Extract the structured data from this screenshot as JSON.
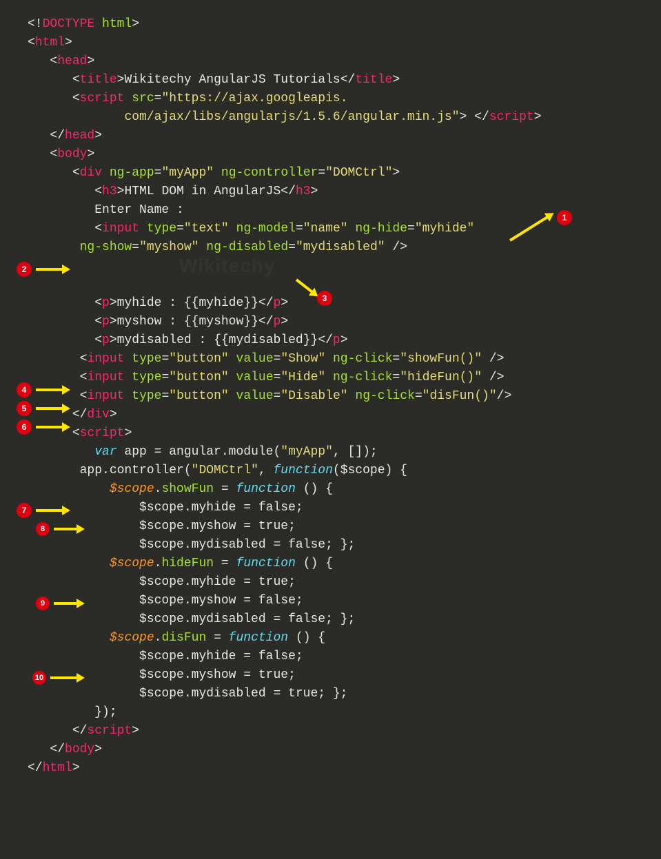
{
  "badges": {
    "b1": "1",
    "b2": "2",
    "b3": "3",
    "b4": "4",
    "b5": "5",
    "b6": "6",
    "b7": "7",
    "b8": "8",
    "b9": "9",
    "b10": "10"
  },
  "code": {
    "doctype_open": "<!",
    "doctype_tag": "DOCTYPE",
    "doctype_html": " html",
    "doctype_close": ">",
    "lt": "<",
    "gt": ">",
    "lt_close": "</",
    "sp_slash_gt": " />",
    "tag_html": "html",
    "tag_head": "head",
    "tag_title": "title",
    "title_text": "Wikitechy AngularJS Tutorials",
    "tag_script": "script",
    "attr_src": "src",
    "eq": "=",
    "src_val_line1": "\"https://ajax.googleapis.",
    "src_val_line2": "com/ajax/libs/angularjs/1.5.6/angular.min.js\"",
    "tag_body": "body",
    "tag_div": "div",
    "attr_ng_app": "ng-app",
    "ng_app_val": "\"myApp\"",
    "attr_ng_controller": "ng-controller",
    "ng_controller_val": "\"DOMCtrl\"",
    "tag_h3": "h3",
    "h3_text": "HTML DOM in AngularJS",
    "enter_name": "Enter Name :",
    "tag_input": "input",
    "attr_type": "type",
    "type_text": "\"text\"",
    "attr_ng_model": "ng-model",
    "ng_model_val": "\"name\"",
    "attr_ng_hide": "ng-hide",
    "ng_hide_val": "\"myhide\"",
    "attr_ng_show": "ng-show",
    "ng_show_val": "\"myshow\"",
    "attr_ng_disabled": "ng-disabled",
    "ng_disabled_val": "\"mydisabled\"",
    "tag_p": "p",
    "p_myhide": "myhide : {{myhide}}",
    "p_myshow": "myshow : {{myshow}}",
    "p_mydisabled": "mydisabled : {{mydisabled}}",
    "type_button": "\"button\"",
    "attr_value": "value",
    "val_show": "\"Show\"",
    "val_hide": "\"Hide\"",
    "val_disable": "\"Disable\"",
    "attr_ng_click": "ng-click",
    "ng_click_show": "\"showFun()\"",
    "ng_click_hide": "\"hideFun()\"",
    "ng_click_dis": "\"disFun()\"",
    "kw_var": "var",
    "js_app": " app ",
    "js_eq": "= ",
    "js_angular_module": "angular.module(",
    "js_myapp_str": "\"myApp\"",
    "js_comma_arr": ", []);",
    "js_app_controller": "app.controller(",
    "js_domctrl_str": "\"DOMCtrl\"",
    "js_comma": ", ",
    "kw_function": "function",
    "js_scope_param": "($scope) {",
    "js_paren_brace": " () {",
    "scope_var": "$scope",
    "dot": ".",
    "fn_showFun": "showFun",
    "fn_hideFun": "hideFun",
    "fn_disFun": "disFun",
    "js_assign_func": " = ",
    "myhide_false": "$scope.myhide = false;",
    "myshow_true": "$scope.myshow = true;",
    "mydisabled_false_close": "$scope.mydisabled = false; };",
    "myhide_true": "$scope.myhide = true;",
    "myshow_false": "$scope.myshow = false;",
    "mydisabled_true_close": "$scope.mydisabled = true; };",
    "js_close_ctrl": "});"
  },
  "watermark": "Wikitechy"
}
